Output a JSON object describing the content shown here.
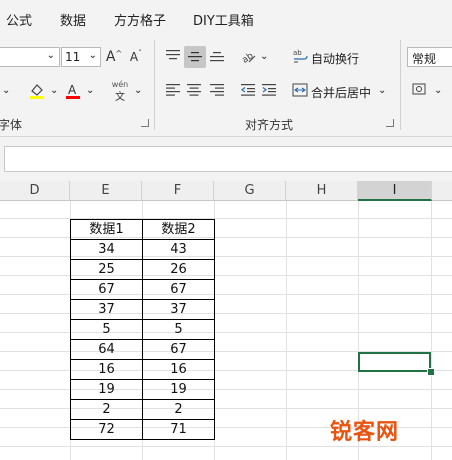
{
  "menu": {
    "tabs": [
      "公式",
      "数据",
      "方方格子",
      "DIY工具箱"
    ]
  },
  "ribbon": {
    "font_size": "11",
    "font_size_increase": "A",
    "font_size_decrease": "A",
    "font_group_label": "字体",
    "phonetic_top": "wén",
    "phonetic_bottom": "文",
    "wrap_text": "自动换行",
    "merge_center": "合并后居中",
    "alignment_group_label": "对齐方式",
    "number_format": "常规",
    "font_color_accent": "#ff0000",
    "fill_color_accent": "#ffff00"
  },
  "sheet": {
    "columns": [
      "D",
      "E",
      "F",
      "G",
      "H",
      "I"
    ],
    "selected_column": "I",
    "table": {
      "headers": [
        "数据1",
        "数据2"
      ],
      "rows": [
        [
          "34",
          "43"
        ],
        [
          "25",
          "26"
        ],
        [
          "67",
          "67"
        ],
        [
          "37",
          "37"
        ],
        [
          "5",
          "5"
        ],
        [
          "64",
          "67"
        ],
        [
          "16",
          "16"
        ],
        [
          "19",
          "19"
        ],
        [
          "2",
          "2"
        ],
        [
          "72",
          "71"
        ]
      ]
    }
  },
  "watermark": "锐客网",
  "colors": {
    "accent": "#217346",
    "watermark": "#e8540f"
  }
}
